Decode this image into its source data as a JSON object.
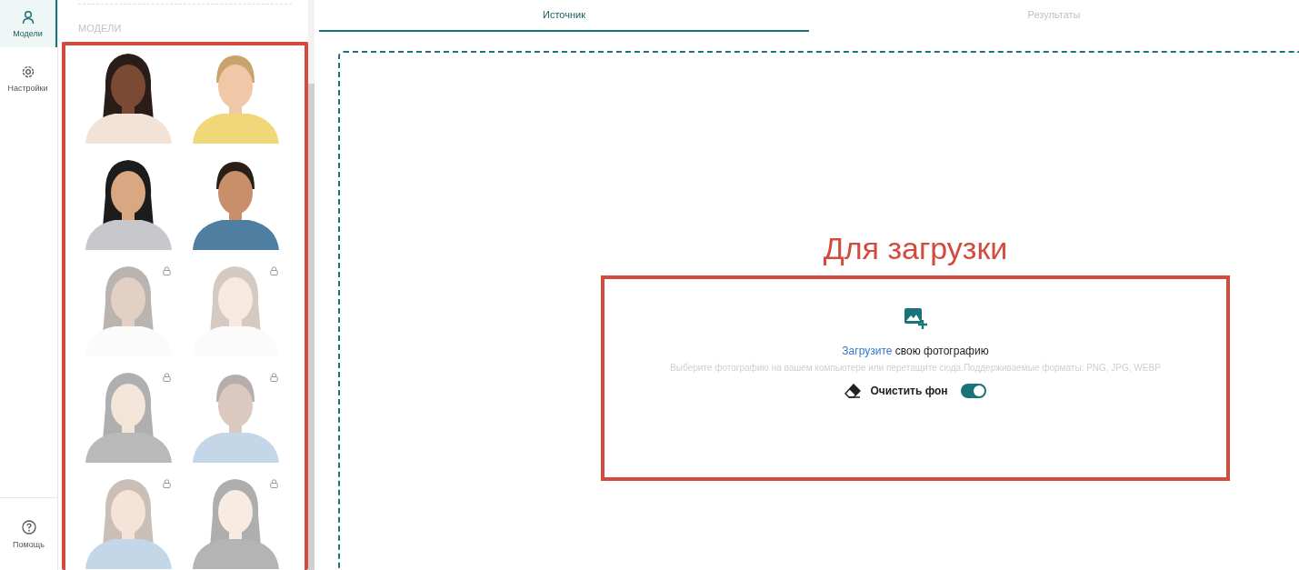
{
  "nav": {
    "items": [
      {
        "label": "Модели",
        "selected": true
      },
      {
        "label": "Настройки",
        "selected": false
      }
    ],
    "help": "Помощь"
  },
  "models_panel": {
    "heading": "МОДЕЛИ",
    "models": [
      {
        "kind": "picture",
        "locked": false
      },
      {
        "kind": "picture",
        "locked": false
      },
      {
        "kind": "picture",
        "locked": false
      },
      {
        "kind": "picture",
        "locked": false
      },
      {
        "kind": "picture",
        "locked": true
      },
      {
        "kind": "picture",
        "locked": true
      },
      {
        "kind": "picture",
        "locked": true
      },
      {
        "kind": "picture",
        "locked": true
      },
      {
        "kind": "picture",
        "locked": true
      },
      {
        "kind": "picture",
        "locked": true
      }
    ]
  },
  "tabs": [
    {
      "label": "Источник",
      "selected": true
    },
    {
      "label": "Результаты",
      "selected": false
    }
  ],
  "annotation": {
    "title": "Для загрузки"
  },
  "upload": {
    "link": "Загрузите",
    "text": "свою фотографию",
    "hint": "Выберите фотографию на вашем компьютере или перетащите сюда.Поддерживаемые форматы: PNG, JPG, WEBP",
    "toggle": {
      "label": "Очистить фон",
      "on": true
    }
  }
}
